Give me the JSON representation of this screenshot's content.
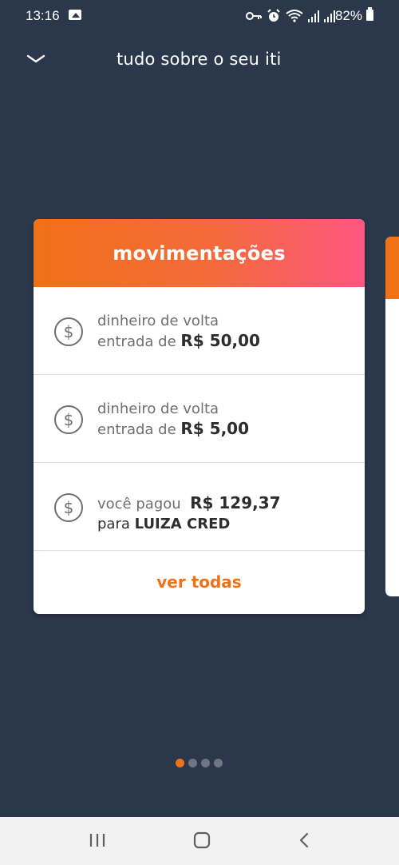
{
  "status_bar": {
    "time": "13:16",
    "battery": "82%",
    "icons": [
      "gallery-icon",
      "key-icon",
      "alarm-icon",
      "wifi-icon",
      "signal-icon",
      "signal-icon",
      "battery-icon"
    ]
  },
  "header": {
    "title": "tudo sobre o seu iti",
    "collapse_icon": "chevron-down-icon"
  },
  "card": {
    "title": "movimentações",
    "transactions": [
      {
        "icon": "dollar-circle-icon",
        "line1": "dinheiro de volta",
        "line2_prefix": "entrada de ",
        "amount": "R$ 50,00"
      },
      {
        "icon": "dollar-circle-icon",
        "line1": "dinheiro de volta",
        "line2_prefix": "entrada de ",
        "amount": "R$ 5,00"
      },
      {
        "icon": "dollar-circle-icon",
        "line1_prefix": "você pagou  ",
        "amount": "R$ 129,37",
        "line2_prefix": "para ",
        "recipient": "LUIZA CRED"
      }
    ],
    "see_all_label": "ver todas"
  },
  "pager": {
    "total": 4,
    "active_index": 0
  },
  "nav_bar": {
    "buttons": [
      "recent-apps-icon",
      "home-icon",
      "back-icon"
    ]
  },
  "colors": {
    "background": "#2b374b",
    "accent_orange": "#ef7118",
    "gradient_pink": "#fe5680"
  }
}
